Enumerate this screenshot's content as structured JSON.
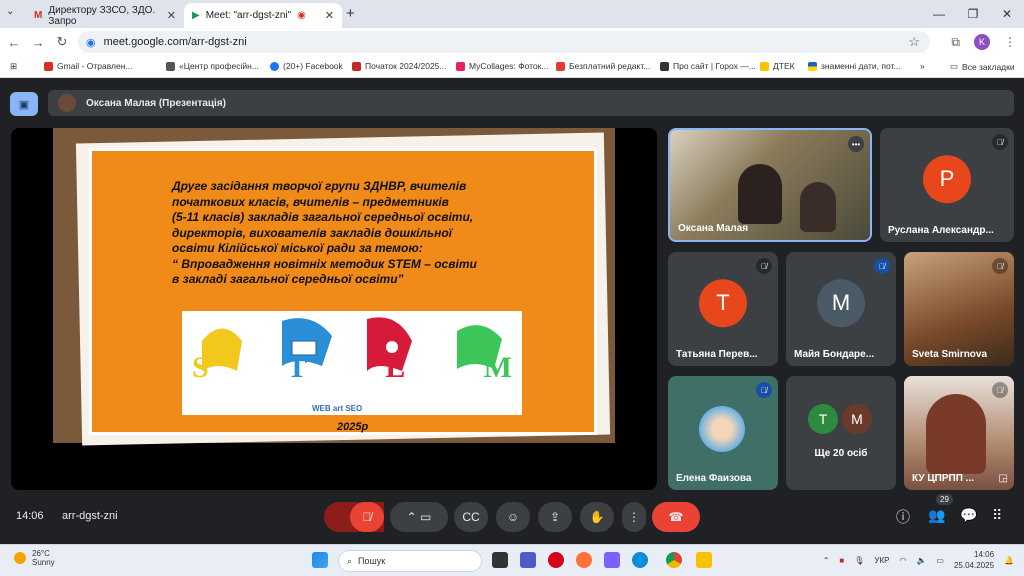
{
  "browser": {
    "tabs": [
      {
        "title": "Директору ЗЗСО, ЗДО. Запро"
      },
      {
        "title": "Meet: \"arr-dgst-zni\""
      }
    ],
    "url": "meet.google.com/arr-dgst-zni",
    "profile_initial": "K",
    "bookmarks": [
      "Gmail - Отравлен...",
      "«Центр професійн...",
      "(20+) Facebook",
      "Початок 2024/2025...",
      "MyCollages: Фоток...",
      "Безплатний редакт...",
      "Про сайт | Горох —...",
      "ДТЕК",
      "знаменні дати, пот...",
      "Все закладки"
    ]
  },
  "meet": {
    "presenter_label": "Оксана Малая (Презентація)",
    "slide": {
      "lines": [
        "Друге засідання творчої групи ЗДНВР, вчителів",
        "початкових класів, вчителів – предметників",
        "(5-11 класів) закладів загальної середньої освіти,",
        "директорів, вихователів закладів дошкільної",
        "освіти Кілійської міської ради за темою:",
        "“ Впровадження новітніх методик STEM – освіти",
        "в закладі загальної середньої освіти”"
      ],
      "stem_letters": [
        "S",
        "T",
        "E",
        "M"
      ],
      "watermark": "WEB art SEO",
      "year": "2025р"
    },
    "participants": [
      {
        "name": "Оксана Малая",
        "initial": "",
        "color": "#6d7a6a"
      },
      {
        "name": "Руслана Александр...",
        "initial": "Р",
        "color": "#e8471c"
      },
      {
        "name": "Татьяна Перев...",
        "initial": "Т",
        "color": "#e8471c"
      },
      {
        "name": "Майя Бондаре...",
        "initial": "М",
        "color": "#4a5a66"
      },
      {
        "name": "Sveta Smirnova",
        "initial": "",
        "color": "#8a5a3a"
      },
      {
        "name": "Елена Фаизова",
        "initial": "",
        "color": "#3f6f66"
      },
      {
        "name": "Ще 20 осіб",
        "initial": "",
        "color": "#3c4043"
      },
      {
        "name": "КУ ЦПРПП ...",
        "initial": "",
        "color": "#b9a8a0"
      }
    ],
    "more_avatars": [
      {
        "initial": "Т",
        "color": "#2e8b3e"
      },
      {
        "initial": "М",
        "color": "#6b3a2a"
      }
    ],
    "time": "14:06",
    "meeting_code": "arr-dgst-zni",
    "participant_count": "29"
  },
  "taskbar": {
    "temp": "26°C",
    "weather": "Sunny",
    "search_placeholder": "Пошук",
    "lang": "УКР",
    "time": "14:06",
    "date": "25.04.2025",
    "weather_badge": "1"
  }
}
